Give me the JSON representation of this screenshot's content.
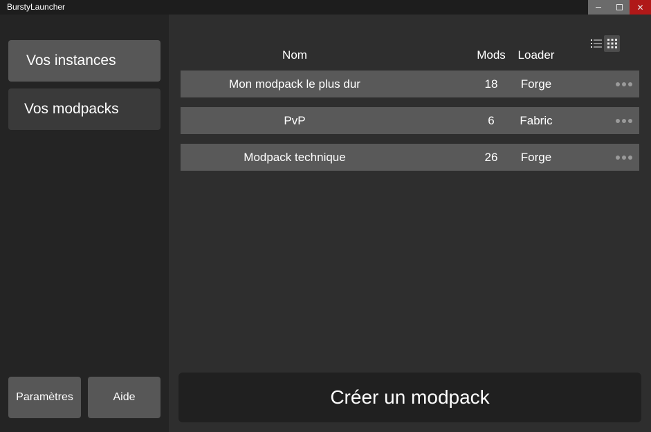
{
  "window": {
    "title": "BurstyLauncher",
    "minimize_icon": "minimize-icon",
    "maximize_icon": "maximize-icon",
    "close_icon": "close-icon",
    "close_glyph": "✕",
    "close_color": "#b01818"
  },
  "sidebar": {
    "items": [
      {
        "label": "Vos instances",
        "active": true
      },
      {
        "label": "Vos modpacks",
        "active": false
      }
    ],
    "settings_label": "Paramètres",
    "help_label": "Aide"
  },
  "main": {
    "view_toggle": {
      "list_icon": "list-view-icon",
      "grid_icon": "grid-view-icon",
      "selected": "grid"
    },
    "columns": {
      "name": "Nom",
      "mods": "Mods",
      "loader": "Loader"
    },
    "rows": [
      {
        "name": "Mon modpack le plus dur",
        "mods": "18",
        "loader": "Forge"
      },
      {
        "name": "PvP",
        "mods": "6",
        "loader": "Fabric"
      },
      {
        "name": "Modpack technique",
        "mods": "26",
        "loader": "Forge"
      }
    ],
    "row_menu_icon": "more-options-icon",
    "create_label": "Créer un modpack"
  }
}
